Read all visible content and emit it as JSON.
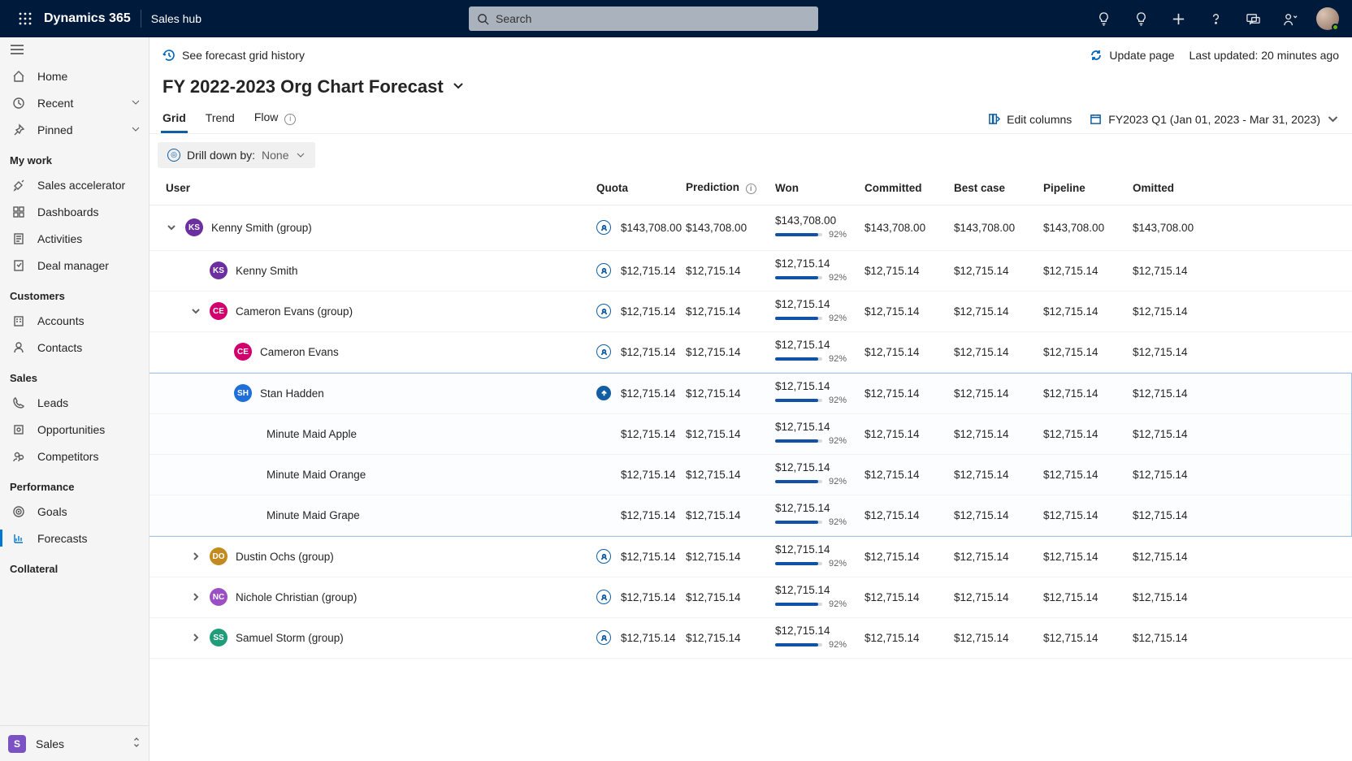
{
  "appbar": {
    "app_name": "Dynamics 365",
    "area": "Sales hub",
    "search_placeholder": "Search"
  },
  "nav": {
    "home": "Home",
    "recent": "Recent",
    "pinned": "Pinned",
    "mywork_header": "My work",
    "sales_accelerator": "Sales accelerator",
    "dashboards": "Dashboards",
    "activities": "Activities",
    "deal_manager": "Deal manager",
    "customers_header": "Customers",
    "accounts": "Accounts",
    "contacts": "Contacts",
    "sales_header": "Sales",
    "leads": "Leads",
    "opportunities": "Opportunities",
    "competitors": "Competitors",
    "performance_header": "Performance",
    "goals": "Goals",
    "forecasts": "Forecasts",
    "collateral_header": "Collateral",
    "area_switcher": "Sales",
    "area_tile": "S"
  },
  "cmd": {
    "history": "See forecast grid history",
    "update": "Update page",
    "last_updated": "Last updated: 20 minutes ago"
  },
  "page": {
    "title": "FY 2022-2023 Org Chart Forecast"
  },
  "tabs": {
    "grid": "Grid",
    "trend": "Trend",
    "flow": "Flow",
    "edit_columns": "Edit columns",
    "period": "FY2023 Q1 (Jan 01, 2023 - Mar 31, 2023)"
  },
  "drill": {
    "label": "Drill down by:",
    "value": "None"
  },
  "columns": {
    "user": "User",
    "quota": "Quota",
    "prediction": "Prediction",
    "won": "Won",
    "committed": "Committed",
    "bestcase": "Best case",
    "pipeline": "Pipeline",
    "omitted": "Omitted"
  },
  "rows": [
    {
      "id": "kenny-group",
      "expand": "down",
      "indent": 0,
      "initials": "KS",
      "color": "#6b2fa0",
      "name": "Kenny Smith (group)",
      "adj": "outline",
      "quota": "$143,708.00",
      "prediction": "$143,708.00",
      "won_amount": "$143,708.00",
      "won_pct": "92%",
      "won_fill": 92,
      "committed": "$143,708.00",
      "bestcase": "$143,708.00",
      "pipeline": "$143,708.00",
      "omitted": "$143,708.00"
    },
    {
      "id": "kenny",
      "expand": "none",
      "indent": 1,
      "initials": "KS",
      "color": "#6b2fa0",
      "name": "Kenny Smith",
      "adj": "outline",
      "quota": "$12,715.14",
      "prediction": "$12,715.14",
      "won_amount": "$12,715.14",
      "won_pct": "92%",
      "won_fill": 92,
      "committed": "$12,715.14",
      "bestcase": "$12,715.14",
      "pipeline": "$12,715.14",
      "omitted": "$12,715.14"
    },
    {
      "id": "cameron-group",
      "expand": "down",
      "indent": 1,
      "initials": "CE",
      "color": "#d1006c",
      "name": "Cameron Evans (group)",
      "adj": "outline",
      "quota": "$12,715.14",
      "prediction": "$12,715.14",
      "won_amount": "$12,715.14",
      "won_pct": "92%",
      "won_fill": 92,
      "committed": "$12,715.14",
      "bestcase": "$12,715.14",
      "pipeline": "$12,715.14",
      "omitted": "$12,715.14"
    },
    {
      "id": "cameron",
      "expand": "none",
      "indent": 2,
      "initials": "CE",
      "color": "#d1006c",
      "name": "Cameron Evans",
      "adj": "outline",
      "quota": "$12,715.14",
      "prediction": "$12,715.14",
      "won_amount": "$12,715.14",
      "won_pct": "92%",
      "won_fill": 92,
      "committed": "$12,715.14",
      "bestcase": "$12,715.14",
      "pipeline": "$12,715.14",
      "omitted": "$12,715.14"
    },
    {
      "id": "stan",
      "expand": "none",
      "indent": 2,
      "initials": "SH",
      "color": "#1e6fd9",
      "name": "Stan Hadden",
      "adj": "solid",
      "quota": "$12,715.14",
      "prediction": "$12,715.14",
      "won_amount": "$12,715.14",
      "won_pct": "92%",
      "won_fill": 92,
      "committed": "$12,715.14",
      "bestcase": "$12,715.14",
      "pipeline": "$12,715.14",
      "omitted": "$12,715.14",
      "selected_group_start": true
    },
    {
      "id": "apple",
      "expand": "leaf",
      "indent": 3,
      "initials": "",
      "color": "",
      "name": "Minute Maid Apple",
      "adj": "none",
      "quota": "$12,715.14",
      "prediction": "$12,715.14",
      "won_amount": "$12,715.14",
      "won_pct": "92%",
      "won_fill": 92,
      "committed": "$12,715.14",
      "bestcase": "$12,715.14",
      "pipeline": "$12,715.14",
      "omitted": "$12,715.14"
    },
    {
      "id": "orange",
      "expand": "leaf",
      "indent": 3,
      "initials": "",
      "color": "",
      "name": "Minute Maid Orange",
      "adj": "none",
      "quota": "$12,715.14",
      "prediction": "$12,715.14",
      "won_amount": "$12,715.14",
      "won_pct": "92%",
      "won_fill": 92,
      "committed": "$12,715.14",
      "bestcase": "$12,715.14",
      "pipeline": "$12,715.14",
      "omitted": "$12,715.14"
    },
    {
      "id": "grape",
      "expand": "leaf",
      "indent": 3,
      "initials": "",
      "color": "",
      "name": "Minute Maid Grape",
      "adj": "none",
      "quota": "$12,715.14",
      "prediction": "$12,715.14",
      "won_amount": "$12,715.14",
      "won_pct": "92%",
      "won_fill": 92,
      "committed": "$12,715.14",
      "bestcase": "$12,715.14",
      "pipeline": "$12,715.14",
      "omitted": "$12,715.14",
      "selected_group_end": true
    },
    {
      "id": "dustin-group",
      "expand": "right",
      "indent": 1,
      "initials": "DO",
      "color": "#c28a1f",
      "name": "Dustin Ochs (group)",
      "adj": "outline",
      "quota": "$12,715.14",
      "prediction": "$12,715.14",
      "won_amount": "$12,715.14",
      "won_pct": "92%",
      "won_fill": 92,
      "committed": "$12,715.14",
      "bestcase": "$12,715.14",
      "pipeline": "$12,715.14",
      "omitted": "$12,715.14"
    },
    {
      "id": "nichole-group",
      "expand": "right",
      "indent": 1,
      "initials": "NC",
      "color": "#9b4fc4",
      "name": "Nichole Christian (group)",
      "adj": "outline",
      "quota": "$12,715.14",
      "prediction": "$12,715.14",
      "won_amount": "$12,715.14",
      "won_pct": "92%",
      "won_fill": 92,
      "committed": "$12,715.14",
      "bestcase": "$12,715.14",
      "pipeline": "$12,715.14",
      "omitted": "$12,715.14"
    },
    {
      "id": "samuel-group",
      "expand": "right",
      "indent": 1,
      "initials": "SS",
      "color": "#1f9c7a",
      "name": "Samuel Storm (group)",
      "adj": "outline",
      "quota": "$12,715.14",
      "prediction": "$12,715.14",
      "won_amount": "$12,715.14",
      "won_pct": "92%",
      "won_fill": 92,
      "committed": "$12,715.14",
      "bestcase": "$12,715.14",
      "pipeline": "$12,715.14",
      "omitted": "$12,715.14"
    }
  ]
}
